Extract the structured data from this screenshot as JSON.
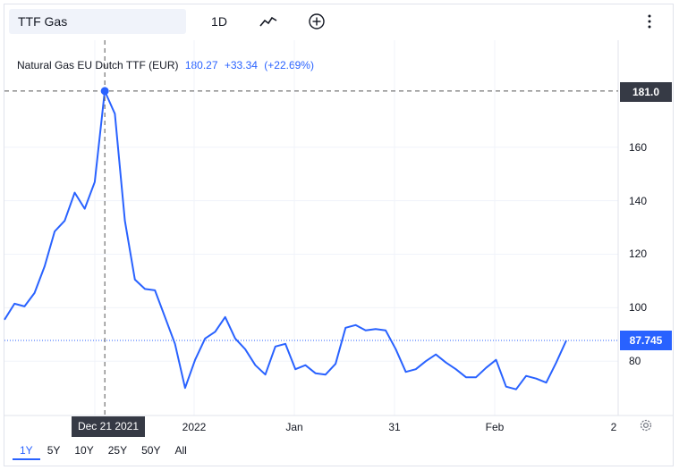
{
  "toolbar": {
    "symbol": "TTF Gas",
    "interval": "1D",
    "chart_type_icon": "line-chart-icon",
    "compare_icon": "plus-circle-icon",
    "more_icon": "vertical-dots-icon"
  },
  "legend": {
    "name": "Natural Gas EU Dutch TTF (EUR)",
    "price": "180.27",
    "change": "+33.34",
    "change_pct": "(+22.69%)"
  },
  "crosshair": {
    "date": "Dec 21 2021",
    "price": "181.0"
  },
  "last_price": "87.745",
  "colors": {
    "line": "#2962ff",
    "tag_dark": "#363a45",
    "grid": "#f0f3fa"
  },
  "ranges": {
    "items": [
      "1Y",
      "5Y",
      "10Y",
      "25Y",
      "50Y",
      "All"
    ],
    "active": "1Y"
  },
  "chart_data": {
    "type": "line",
    "x_labels": [
      "2022",
      "Jan",
      "31",
      "Feb",
      "2"
    ],
    "y_ticks": [
      80,
      100,
      120,
      140,
      160
    ],
    "ylim": [
      59.7,
      200
    ],
    "series": [
      {
        "values": [
          95.5,
          101.5,
          100.5,
          105.5,
          115.5,
          128.5,
          132.5,
          143.0,
          137.0,
          147.0,
          181.0,
          172.5,
          132.5,
          110.5,
          107.0,
          106.5,
          96.5,
          86.5,
          70.0,
          80.5,
          88.5,
          91.0,
          96.5,
          88.5,
          84.5,
          78.5,
          75.0,
          85.5,
          86.5,
          77.0,
          78.5,
          75.5,
          75.0,
          79.0,
          92.5,
          93.5,
          91.5,
          92.0,
          91.5,
          84.5,
          76.0,
          77.0,
          80.0,
          82.5,
          79.5,
          77.0,
          74.0,
          74.0,
          77.5,
          80.5,
          70.5,
          69.5,
          74.5,
          73.5,
          72.0,
          79.5,
          87.745
        ]
      }
    ]
  }
}
